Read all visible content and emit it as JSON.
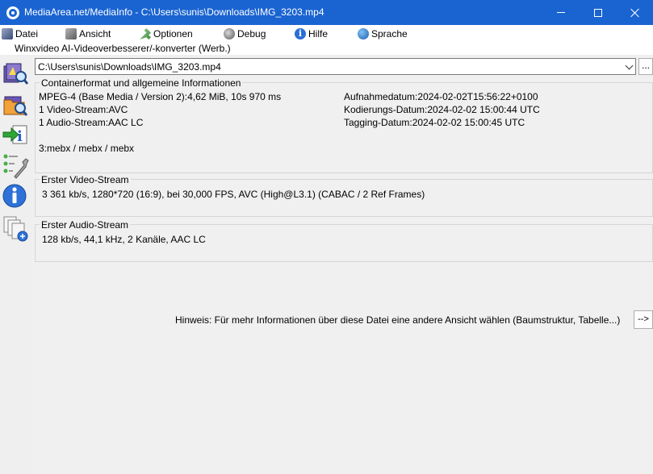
{
  "window": {
    "title": "MediaArea.net/MediaInfo - C:\\Users\\sunis\\Downloads\\IMG_3203.mp4"
  },
  "menu": {
    "items": [
      {
        "label": "Datei",
        "icon": "file-icon"
      },
      {
        "label": "Ansicht",
        "icon": "view-icon"
      },
      {
        "label": "Optionen",
        "icon": "tools-icon"
      },
      {
        "label": "Debug",
        "icon": "debug-icon"
      },
      {
        "label": "Hilfe",
        "icon": "help-icon"
      },
      {
        "label": "Sprache",
        "icon": "globe-icon"
      }
    ]
  },
  "ad": {
    "text": "Winxvideo AI-Videoverbesserer/-konverter (Werb.)"
  },
  "sidebar": {
    "icons": [
      "open-file-icon",
      "open-folder-icon",
      "export-icon",
      "preferences-icon",
      "about-icon",
      "knowledge-base-icon"
    ]
  },
  "file": {
    "path": "C:\\Users\\sunis\\Downloads\\IMG_3203.mp4",
    "browse_label": "..."
  },
  "general": {
    "heading": "Containerformat und allgemeine Informationen",
    "format": "MPEG-4 (Base Media / Version 2):4,62 MiB, 10s 970 ms",
    "video_count": "1 Video-Stream:AVC",
    "audio_count": "1 Audio-Stream:AAC LC",
    "brands": "3:mebx / mebx / mebx",
    "recorded_date": "Aufnahmedatum:2024-02-02T15:56:22+0100",
    "encoded_date": "Kodierungs-Datum:2024-02-02 15:00:44 UTC",
    "tagged_date": "Tagging-Datum:2024-02-02 15:00:45 UTC"
  },
  "video": {
    "heading": "Erster Video-Stream",
    "details": "3 361 kb/s, 1280*720 (16:9), bei 30,000 FPS, AVC (High@L3.1) (CABAC / 2 Ref Frames)"
  },
  "audio": {
    "heading": "Erster Audio-Stream",
    "details": "128 kb/s, 44,1 kHz, 2 Kanäle, AAC LC"
  },
  "hint": {
    "text": "Hinweis: Für mehr Informationen über diese Datei eine andere Ansicht wählen (Baumstruktur, Tabelle...)",
    "button_label": "-->"
  },
  "colors": {
    "titlebar": "#1a64d2",
    "panel": "#f0f0f0"
  }
}
